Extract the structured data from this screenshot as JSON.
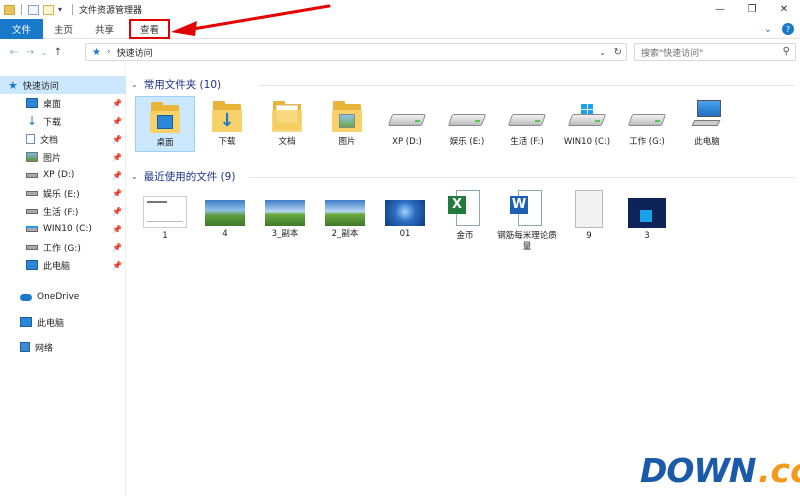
{
  "window": {
    "title": "文件资源管理器",
    "controls": [
      "—",
      "❐",
      "✕"
    ]
  },
  "ribbon": {
    "tabs": [
      {
        "label": "文件",
        "active": true
      },
      {
        "label": "主页"
      },
      {
        "label": "共享"
      },
      {
        "label": "查看",
        "highlighted": true
      }
    ],
    "right": {
      "expand": "⌄",
      "help": "?"
    }
  },
  "nav": {
    "back": "←",
    "forward": "→",
    "recent": "⌄",
    "up": "↑"
  },
  "address": {
    "crumb": "快速访问",
    "refresh": "↻",
    "dropdown": "⌄"
  },
  "search": {
    "placeholder": "搜索\"快速访问\""
  },
  "sidebar": {
    "quick_access": "快速访问",
    "items": [
      {
        "label": "桌面",
        "icon": "desktop-icon"
      },
      {
        "label": "下载",
        "icon": "download-icon"
      },
      {
        "label": "文档",
        "icon": "document-icon"
      },
      {
        "label": "图片",
        "icon": "picture-icon"
      },
      {
        "label": "XP (D:)",
        "icon": "drive-icon"
      },
      {
        "label": "娱乐 (E:)",
        "icon": "drive-icon"
      },
      {
        "label": "生活 (F:)",
        "icon": "drive-icon"
      },
      {
        "label": "WIN10 (C:)",
        "icon": "windows-drive-icon"
      },
      {
        "label": "工作 (G:)",
        "icon": "drive-icon"
      },
      {
        "label": "此电脑",
        "icon": "computer-icon"
      }
    ],
    "onedrive": "OneDrive",
    "this_pc": "此电脑",
    "network": "网络"
  },
  "frequent": {
    "heading": "常用文件夹 (10)",
    "items": [
      {
        "label": "桌面",
        "kind": "desktop"
      },
      {
        "label": "下载",
        "kind": "download"
      },
      {
        "label": "文档",
        "kind": "document"
      },
      {
        "label": "图片",
        "kind": "picture"
      },
      {
        "label": "XP (D:)",
        "kind": "drive"
      },
      {
        "label": "娱乐 (E:)",
        "kind": "drive"
      },
      {
        "label": "生活 (F:)",
        "kind": "drive"
      },
      {
        "label": "WIN10 (C:)",
        "kind": "windrive"
      },
      {
        "label": "工作 (G:)",
        "kind": "drive"
      },
      {
        "label": "此电脑",
        "kind": "pc"
      }
    ]
  },
  "recent": {
    "heading": "最近使用的文件 (9)",
    "items": [
      {
        "label": "1",
        "kind": "doc-thumb"
      },
      {
        "label": "4",
        "kind": "landscape"
      },
      {
        "label": "3_副本",
        "kind": "landscape"
      },
      {
        "label": "2_副本",
        "kind": "landscape"
      },
      {
        "label": "01",
        "kind": "win7"
      },
      {
        "label": "金币",
        "kind": "excel"
      },
      {
        "label": "钢筋每米理论质量",
        "kind": "word"
      },
      {
        "label": "9",
        "kind": "gray-doc"
      },
      {
        "label": "3",
        "kind": "win8"
      }
    ]
  },
  "watermark": {
    "part1": "DOWN",
    "part2": ".cc"
  },
  "colors": {
    "accent": "#1979ca",
    "selection": "#cce8ff",
    "group_heading": "#1e3287",
    "annotation": "#e20000",
    "folder": "#e8b53a"
  }
}
